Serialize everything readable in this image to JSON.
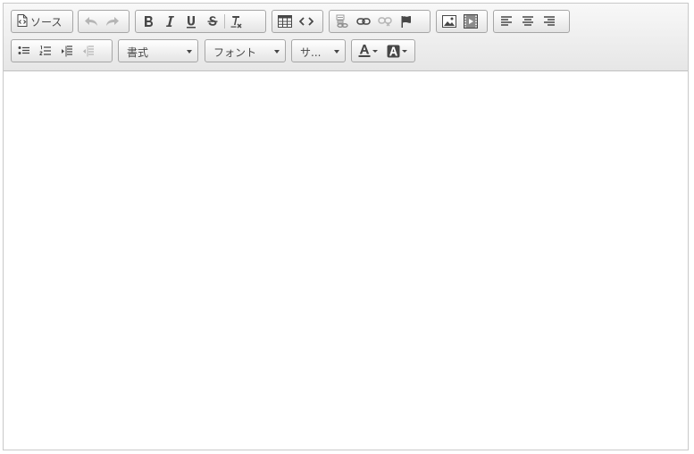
{
  "toolbar": {
    "source_label": "ソース",
    "format_combo": "書式",
    "font_combo": "フォント",
    "size_combo": "サ..."
  },
  "icons": {
    "row1": [
      "source-icon",
      "undo-icon",
      "redo-icon",
      "bold-icon",
      "italic-icon",
      "underline-icon",
      "strikethrough-icon",
      "remove-format-icon",
      "table-icon",
      "code-icon",
      "paste-from-word-icon",
      "link-icon",
      "unlink-icon",
      "anchor-icon",
      "image-icon",
      "video-icon",
      "align-left-icon",
      "align-center-icon",
      "align-right-icon"
    ],
    "row2": [
      "bulleted-list-icon",
      "numbered-list-icon",
      "indent-icon",
      "outdent-icon",
      "text-color-icon",
      "background-color-icon"
    ]
  },
  "colors": {
    "toolbar_top": "#f8f8f8",
    "toolbar_bottom": "#e6e6e6",
    "border": "#a6a6a6",
    "icon": "#474747",
    "disabled_icon": "#b5b5b5"
  }
}
